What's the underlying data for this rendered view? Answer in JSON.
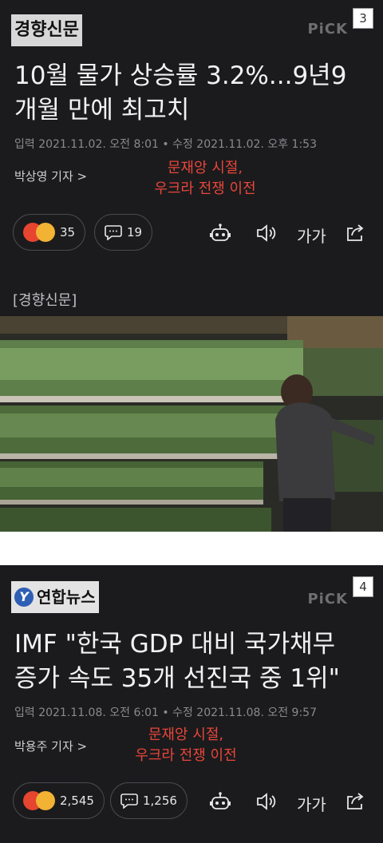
{
  "articles": [
    {
      "publisher": "경향신문",
      "pick": "PiCK",
      "rank": "3",
      "headline_line1": "10월 물가 상승률 3.2%...9년9",
      "headline_line2": "개월 만에 최고치",
      "meta": "입력 2021.11.02. 오전 8:01 • 수정 2021.11.02. 오후 1:53",
      "reporter": "박상영 기자 >",
      "note_line1": "문재앙 시절,",
      "note_line2": "우크라 전쟁 이전",
      "reactions": "35",
      "comments": "19",
      "font_label": "가가",
      "image_caption": "[경향신문]"
    },
    {
      "publisher": "연합뉴스",
      "pick": "PiCK",
      "rank": "4",
      "headline_line1": "IMF \"한국 GDP 대비 국가채무",
      "headline_line2": "증가 속도 35개 선진국 중 1위\"",
      "meta": "입력 2021.11.08. 오전 6:01 • 수정 2021.11.08. 오전 9:57",
      "reporter": "박용주 기자 >",
      "note_line1": "문재앙 시절,",
      "note_line2": "우크라 전쟁 이전",
      "reactions": "2,545",
      "comments": "1,256",
      "font_label": "가가"
    }
  ],
  "icons": {
    "comment": "speech-bubble-icon",
    "bot": "robot-icon",
    "audio": "speaker-icon",
    "share": "share-icon"
  },
  "colors": {
    "background": "#1b1b1d",
    "note": "#e8463a"
  }
}
